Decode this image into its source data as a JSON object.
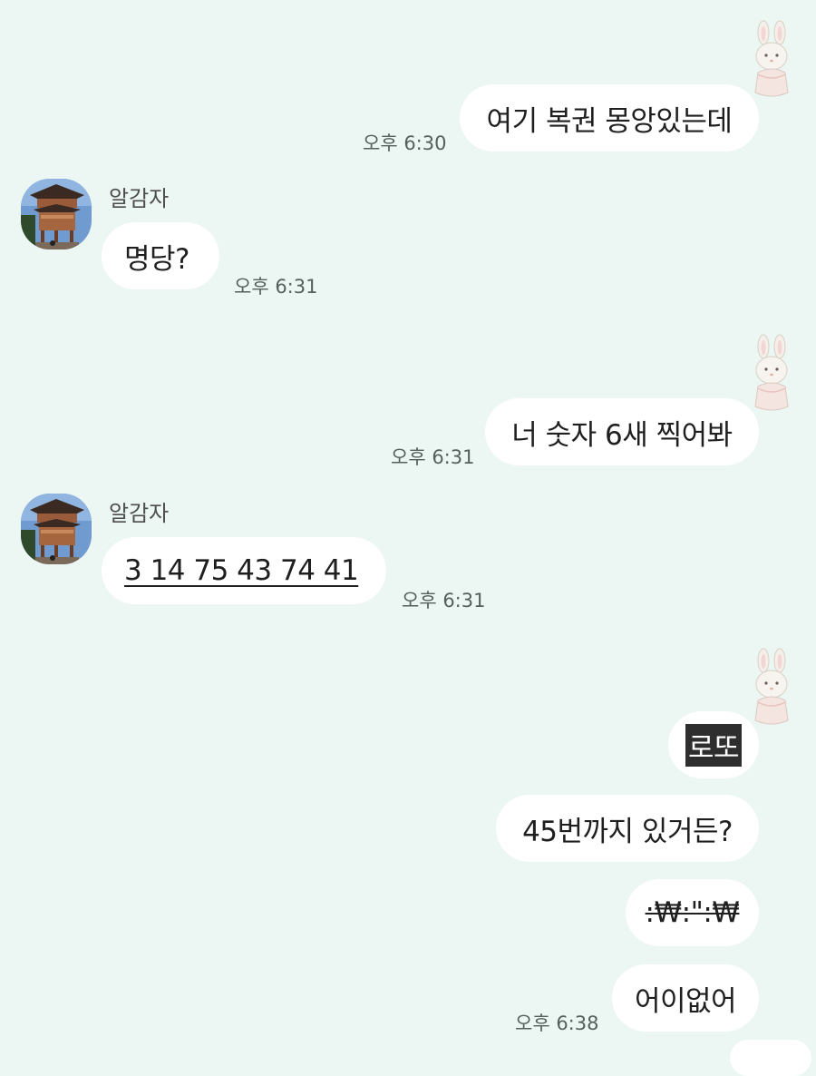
{
  "messages": [
    {
      "id": "m1",
      "side": "right",
      "text": "여기 복권 몽앙있는데",
      "time": "오후 6:30"
    },
    {
      "id": "m2",
      "side": "left",
      "sender": "알감자",
      "text": "명당?",
      "time": "오후 6:31"
    },
    {
      "id": "m3",
      "side": "right",
      "text": "너 숫자 6새 찍어봐",
      "time": "오후 6:31"
    },
    {
      "id": "m4",
      "side": "left",
      "sender": "알감자",
      "text": "3 14 75 43 74 41",
      "time": "오후 6:31"
    },
    {
      "id": "m5",
      "side": "right",
      "text": "로또"
    },
    {
      "id": "m6",
      "side": "right",
      "text": "45번까지 있거든?"
    },
    {
      "id": "m7",
      "side": "right",
      "text": ":₩:\":₩"
    },
    {
      "id": "m8",
      "side": "right",
      "text": "어이없어",
      "time": "오후 6:38"
    }
  ],
  "icons": {
    "my_avatar": "bunny-sticker-icon",
    "partner_avatar": "pavilion-photo-avatar"
  },
  "colors": {
    "background": "#ecf6f2",
    "bubble": "#ffffff",
    "timestamp": "#555f5b"
  }
}
